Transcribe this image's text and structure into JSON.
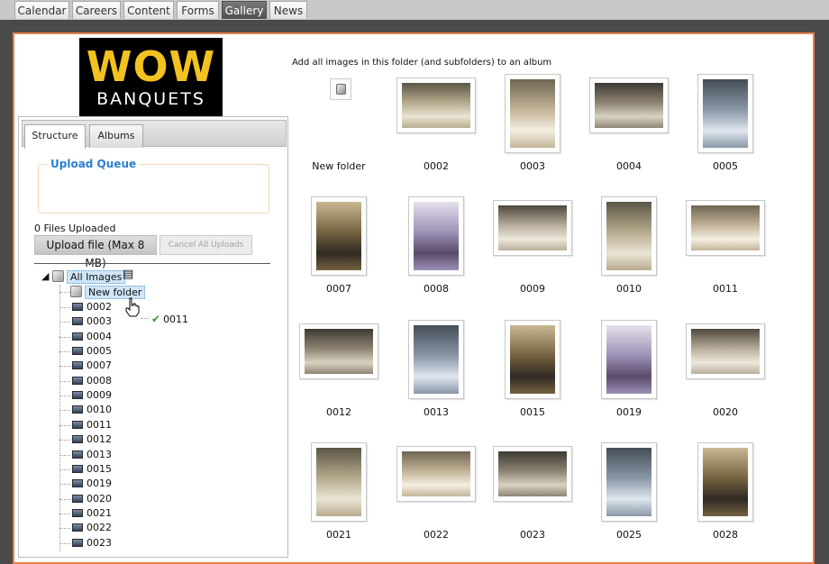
{
  "nav_tabs": [
    {
      "label": "Calendar"
    },
    {
      "label": "Careers"
    },
    {
      "label": "Content"
    },
    {
      "label": "Forms"
    },
    {
      "label": "Gallery",
      "active": true
    },
    {
      "label": "News"
    }
  ],
  "logo": {
    "line1": "WOW",
    "line2": "BANQUETS"
  },
  "panel": {
    "tabs": [
      {
        "label": "Structure",
        "active": true
      },
      {
        "label": "Albums"
      }
    ],
    "upload_queue_title": "Upload Queue",
    "files_uploaded": "0 Files Uploaded",
    "upload_button": "Upload file (Max 8 MB)",
    "cancel_button": "Cancel All Uploads"
  },
  "tree": {
    "root": "All Images",
    "new_folder": "New folder",
    "items": [
      "0002",
      "0003",
      "0004",
      "0005",
      "0007",
      "0008",
      "0009",
      "0010",
      "0011",
      "0012",
      "0013",
      "0015",
      "0019",
      "0020",
      "0021",
      "0022",
      "0023"
    ],
    "drag_item": "0011"
  },
  "gallery": {
    "title": "Add all images in this folder (and subfolders) to an album",
    "new_folder_label": "New folder",
    "items": [
      "0002",
      "0003",
      "0004",
      "0005",
      "0007",
      "0008",
      "0009",
      "0010",
      "0011",
      "0012",
      "0013",
      "0015",
      "0019",
      "0020",
      "0021",
      "0022",
      "0023",
      "0025",
      "0028"
    ]
  },
  "colors": {
    "accent_border": "#e8804a",
    "queue_title": "#2b7fd0",
    "active_tab": "#555555"
  }
}
